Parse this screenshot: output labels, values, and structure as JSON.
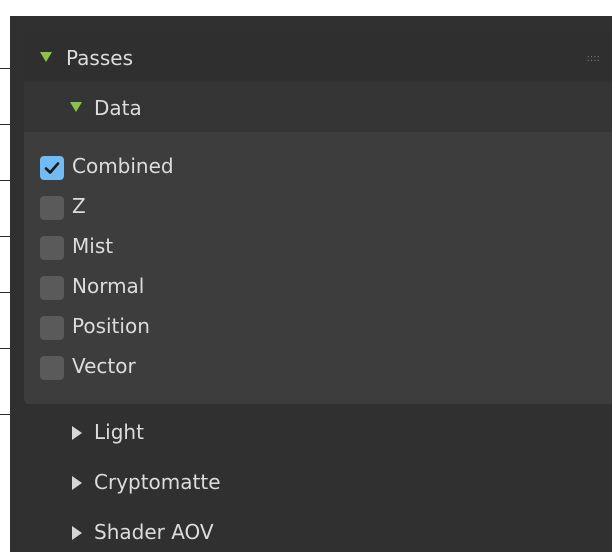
{
  "panel": {
    "title": "Passes",
    "drag_handle": "::::",
    "icon_expanded": "triangle-down-icon"
  },
  "data_section": {
    "title": "Data",
    "expanded": true,
    "items": [
      {
        "label": "Combined",
        "checked": true
      },
      {
        "label": "Z",
        "checked": false
      },
      {
        "label": "Mist",
        "checked": false
      },
      {
        "label": "Normal",
        "checked": false
      },
      {
        "label": "Position",
        "checked": false
      },
      {
        "label": "Vector",
        "checked": false
      }
    ]
  },
  "subpanels": [
    {
      "label": "Light",
      "expanded": false
    },
    {
      "label": "Cryptomatte",
      "expanded": false
    },
    {
      "label": "Shader AOV",
      "expanded": false
    }
  ],
  "colors": {
    "accent_check": "#71baf4",
    "expand_triangle": "#8cc24e",
    "background": "#303030",
    "panel": "#3d3d3d"
  }
}
